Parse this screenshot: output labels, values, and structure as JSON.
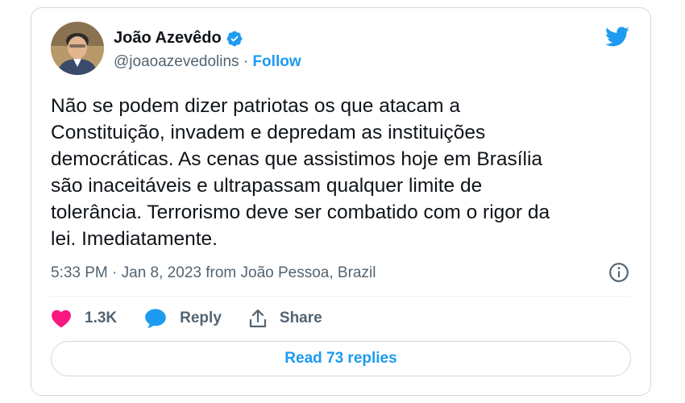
{
  "author": {
    "name": "João Azevêdo",
    "handle": "@joaoazevedolins",
    "separator": "·",
    "follow_label": "Follow"
  },
  "tweet": {
    "text": "Não se podem dizer patriotas os que atacam a\nConstituição, invadem e depredam as instituições\ndemocráticas. As cenas que assistimos hoje em Brasília\nsão inaceitáveis e ultrapassam qualquer limite de\ntolerância. Terrorismo deve ser combatido com o rigor da\nlei. Imediatamente.",
    "timestamp": "5:33 PM · Jan 8, 2023 from João Pessoa, Brazil"
  },
  "actions": {
    "like_count": "1.3K",
    "reply_label": "Reply",
    "share_label": "Share"
  },
  "read_replies_label": "Read 73 replies",
  "colors": {
    "accent": "#1d9bf0",
    "like": "#f91880",
    "text": "#0f1419",
    "muted": "#536471",
    "border": "#cfd9de"
  },
  "icons": [
    "verified-badge-icon",
    "twitter-bird-icon",
    "info-icon",
    "heart-icon",
    "reply-bubble-icon",
    "share-icon"
  ]
}
